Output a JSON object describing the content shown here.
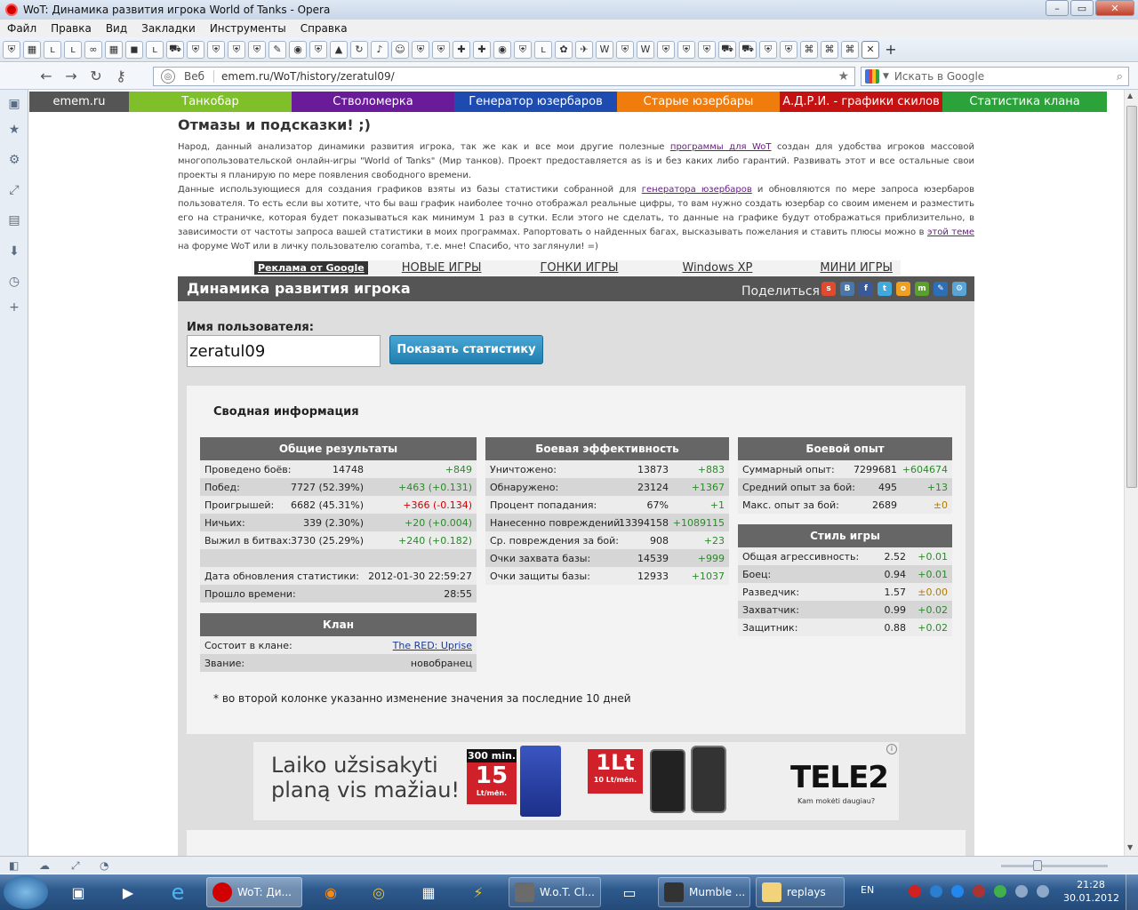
{
  "window": {
    "title": "WoT: Динамика развития игрока World of Tanks - Opera",
    "controls": [
      "–",
      "▭",
      "✕"
    ]
  },
  "menu": [
    "Файл",
    "Правка",
    "Вид",
    "Закладки",
    "Инструменты",
    "Справка"
  ],
  "addressbar": {
    "mode_label": "Веб",
    "url": "emem.ru/WoT/history/zeratul09/",
    "search_placeholder": "Искать в Google"
  },
  "site_nav": [
    {
      "label": "emem.ru",
      "color": "#555555"
    },
    {
      "label": "Танкобар",
      "color": "#7fbf2a"
    },
    {
      "label": "Стволомерка",
      "color": "#6a1b9a"
    },
    {
      "label": "Генератор юзербаров",
      "color": "#1e4bb0"
    },
    {
      "label": "Старые юзербары",
      "color": "#f07c0e"
    },
    {
      "label": "А.Д.Р.И. - графики скилов",
      "color": "#c41212"
    },
    {
      "label": "Статистика клана",
      "color": "#2ba33a"
    }
  ],
  "hints": {
    "title": "Отмазы и подсказки! ;)",
    "p1_a": "Народ, данный анализатор динамики развития игрока, так же как и все мои другие полезные ",
    "p1_link": "программы для WoT",
    "p1_b": " создан для удобства игроков массовой многопользовательской онлайн-игры \"World of Tanks\" (Мир танков). Проект предоставляется as is и без каких либо гарантий. Развивать этот и все остальные свои проекты я планирую по мере появления свободного времени.",
    "p2_a": "Данные использующиеся для создания графиков взяты из базы статистики собранной для ",
    "p2_link": "генератора юзербаров",
    "p2_b": " и обновляются по мере запроса юзербаров пользователя. То есть если вы хотите, что бы ваш график наиболее точно отображал реальные цифры, то вам нужно создать юзербар со своим именем и разместить его на страничке, которая будет показываться как минимум 1 раз в сутки. Если этого не сделать, то данные на графике будут отображаться приблизительно, в зависимости от частоты запроса вашей статистики в моих программах. Рапортовать о найденных багах, высказывать пожелания и ставить плюсы можно в ",
    "p2_link2": "этой теме",
    "p2_c": " на форуме WoT или в личку пользователю coramba, т.е. мне! Спасибо, что заглянули! =)"
  },
  "ad_links": {
    "google": "Реклама от Google",
    "items": [
      "НОВЫЕ ИГРЫ",
      "ГОНКИ ИГРЫ",
      "Windows XP",
      "МИНИ ИГРЫ"
    ]
  },
  "panel": {
    "title": "Динамика развития игрока",
    "share_label": "Поделиться",
    "username_label": "Имя пользователя:",
    "username_value": "zeratul09",
    "show_button": "Показать статистику",
    "summary_title": "Сводная информация",
    "note": "* во второй колонке указанно изменение значения за последние 10 дней"
  },
  "general": {
    "header": "Общие результаты",
    "rows": [
      {
        "label": "Проведено боёв:",
        "value": "14748",
        "delta": "+849",
        "sign": "pos"
      },
      {
        "label": "Побед:",
        "value": "7727 (52.39%)",
        "delta": "+463 (+0.131)",
        "sign": "pos"
      },
      {
        "label": "Проигрышей:",
        "value": "6682 (45.31%)",
        "delta": "+366 (-0.134)",
        "sign": "neg"
      },
      {
        "label": "Ничьих:",
        "value": "339 (2.30%)",
        "delta": "+20 (+0.004)",
        "sign": "pos"
      },
      {
        "label": "Выжил в битвах:",
        "value": "3730 (25.29%)",
        "delta": "+240 (+0.182)",
        "sign": "pos"
      },
      {
        "label": "",
        "value": "",
        "delta": "",
        "sign": "pos"
      },
      {
        "label": "Дата обновления статистики:",
        "value": "2012-01-30 22:59:27",
        "delta": "",
        "sign": "pos"
      },
      {
        "label": "Прошло времени:",
        "value": "28:55",
        "delta": "",
        "sign": "pos"
      }
    ]
  },
  "clan": {
    "header": "Клан",
    "member_label": "Состоит в клане:",
    "member_value": "The RED: Uprise",
    "rank_label": "Звание:",
    "rank_value": "новобранец"
  },
  "combat": {
    "header": "Боевая эффективность",
    "rows": [
      {
        "label": "Уничтожено:",
        "value": "13873",
        "delta": "+883",
        "sign": "pos"
      },
      {
        "label": "Обнаружено:",
        "value": "23124",
        "delta": "+1367",
        "sign": "pos"
      },
      {
        "label": "Процент попадания:",
        "value": "67%",
        "delta": "+1",
        "sign": "pos"
      },
      {
        "label": "Нанесенно повреждений:",
        "value": "13394158",
        "delta": "+1089115",
        "sign": "pos"
      },
      {
        "label": "Ср. повреждения за бой:",
        "value": "908",
        "delta": "+23",
        "sign": "pos"
      },
      {
        "label": "Очки захвата базы:",
        "value": "14539",
        "delta": "+999",
        "sign": "pos"
      },
      {
        "label": "Очки защиты базы:",
        "value": "12933",
        "delta": "+1037",
        "sign": "pos"
      }
    ]
  },
  "experience": {
    "header": "Боевой опыт",
    "rows": [
      {
        "label": "Суммарный опыт:",
        "value": "7299681",
        "delta": "+604674",
        "sign": "pos"
      },
      {
        "label": "Средний опыт за бой:",
        "value": "495",
        "delta": "+13",
        "sign": "pos"
      },
      {
        "label": "Макс. опыт за бой:",
        "value": "2689",
        "delta": "±0",
        "sign": "neu"
      }
    ]
  },
  "style": {
    "header": "Стиль игры",
    "rows": [
      {
        "label": "Общая агрессивность:",
        "value": "2.52",
        "delta": "+0.01",
        "sign": "pos"
      },
      {
        "label": "Боец:",
        "value": "0.94",
        "delta": "+0.01",
        "sign": "pos"
      },
      {
        "label": "Разведчик:",
        "value": "1.57",
        "delta": "±0.00",
        "sign": "neu"
      },
      {
        "label": "Захватчик:",
        "value": "0.99",
        "delta": "+0.02",
        "sign": "pos"
      },
      {
        "label": "Защитник:",
        "value": "0.88",
        "delta": "+0.02",
        "sign": "pos"
      }
    ]
  },
  "banner": {
    "text_line1": "Laiko užsisakyti",
    "text_line2": "planą vis mažiau!",
    "minutes": "300 min.",
    "big15": "15",
    "unit": "Lt/mėn.",
    "lt": "1Lt",
    "lt_unit": "10 Lt/mėn.",
    "brand": "TELE2",
    "slogan": "Kam mokėti daugiau?"
  },
  "taskbar": {
    "buttons": [
      "WoT: Ди...",
      "W.o.T. Cl...",
      "Mumble ...",
      "replays"
    ],
    "lang": "EN",
    "time": "21:28",
    "date": "30.01.2012"
  }
}
